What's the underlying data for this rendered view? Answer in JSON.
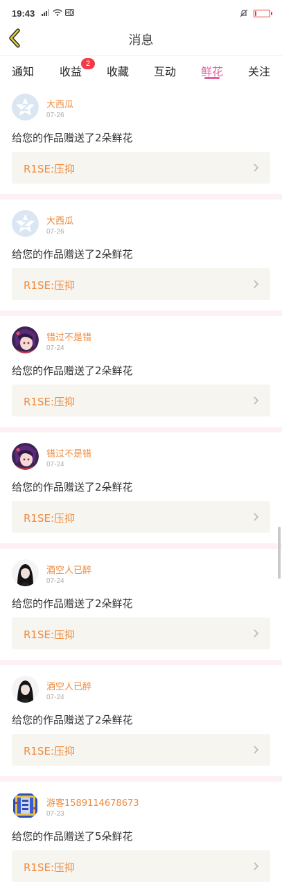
{
  "status_bar": {
    "time": "19:43",
    "battery_level": 0.12
  },
  "header": {
    "title": "消息"
  },
  "tabs": [
    {
      "label": "通知",
      "active": false,
      "badge": ""
    },
    {
      "label": "收益",
      "active": false,
      "badge": "2"
    },
    {
      "label": "收藏",
      "active": false,
      "badge": ""
    },
    {
      "label": "互动",
      "active": false,
      "badge": ""
    },
    {
      "label": "鲜花",
      "active": true,
      "badge": ""
    },
    {
      "label": "关注",
      "active": false,
      "badge": ""
    }
  ],
  "items": [
    {
      "user": "大西瓜",
      "date": "07-26",
      "message": "给您的作品赠送了2朵鲜花",
      "work": "R1SE:压抑",
      "avatar": "default-avatar-icon"
    },
    {
      "user": "大西瓜",
      "date": "07-26",
      "message": "给您的作品赠送了2朵鲜花",
      "work": "R1SE:压抑",
      "avatar": "default-avatar-icon"
    },
    {
      "user": "错过不是错",
      "date": "07-24",
      "message": "给您的作品赠送了2朵鲜花",
      "work": "R1SE:压抑",
      "avatar": "anime-avatar"
    },
    {
      "user": "错过不是错",
      "date": "07-24",
      "message": "给您的作品赠送了2朵鲜花",
      "work": "R1SE:压抑",
      "avatar": "anime-avatar"
    },
    {
      "user": "酒空人已醉",
      "date": "07-24",
      "message": "给您的作品赠送了2朵鲜花",
      "work": "R1SE:压抑",
      "avatar": "portrait-avatar"
    },
    {
      "user": "酒空人已醉",
      "date": "07-24",
      "message": "给您的作品赠送了2朵鲜花",
      "work": "R1SE:压抑",
      "avatar": "portrait-avatar"
    },
    {
      "user": "游客1589114678673",
      "date": "07-23",
      "message": "给您的作品赠送了5朵鲜花",
      "work": "R1SE:压抑",
      "avatar": "pixel-avatar"
    }
  ],
  "colors": {
    "accent": "#e2609a",
    "username": "#ef8a3d",
    "badge": "#f23a48",
    "separator": "#fdf1f3",
    "work_bg": "#f6f5ef"
  }
}
